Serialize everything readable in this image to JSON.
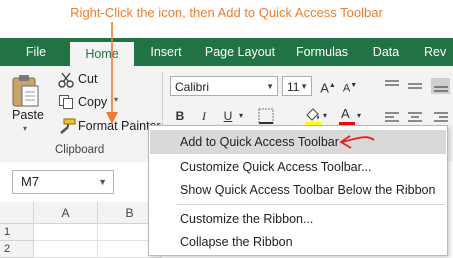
{
  "instruction": "Right-Click the icon, then Add to Quick Access Toolbar",
  "colors": {
    "accent": "#ED7D31",
    "excel_green": "#217346",
    "annotation_red": "#E81E1E"
  },
  "tabs": [
    {
      "label": "File"
    },
    {
      "label": "Home"
    },
    {
      "label": "Insert"
    },
    {
      "label": "Page Layout"
    },
    {
      "label": "Formulas"
    },
    {
      "label": "Data"
    },
    {
      "label": "Rev"
    }
  ],
  "clipboard": {
    "paste": "Paste",
    "cut": "Cut",
    "copy": "Copy",
    "format_painter": "Format Painter",
    "group_label": "Clipboard"
  },
  "font": {
    "name": "Calibri",
    "size": "11"
  },
  "formatting": {
    "bold": "B",
    "italic": "I",
    "underline": "U",
    "font_color": "A"
  },
  "name_box": "M7",
  "columns": [
    "A",
    "B"
  ],
  "rows": [
    "1",
    "2"
  ],
  "context_menu": [
    {
      "label": "Add to Quick Access Toolbar",
      "highlighted": true
    },
    {
      "label": "Customize Quick Access Toolbar..."
    },
    {
      "label": "Show Quick Access Toolbar Below the Ribbon"
    },
    {
      "label": "Customize the Ribbon..."
    },
    {
      "label": "Collapse the Ribbon"
    }
  ]
}
